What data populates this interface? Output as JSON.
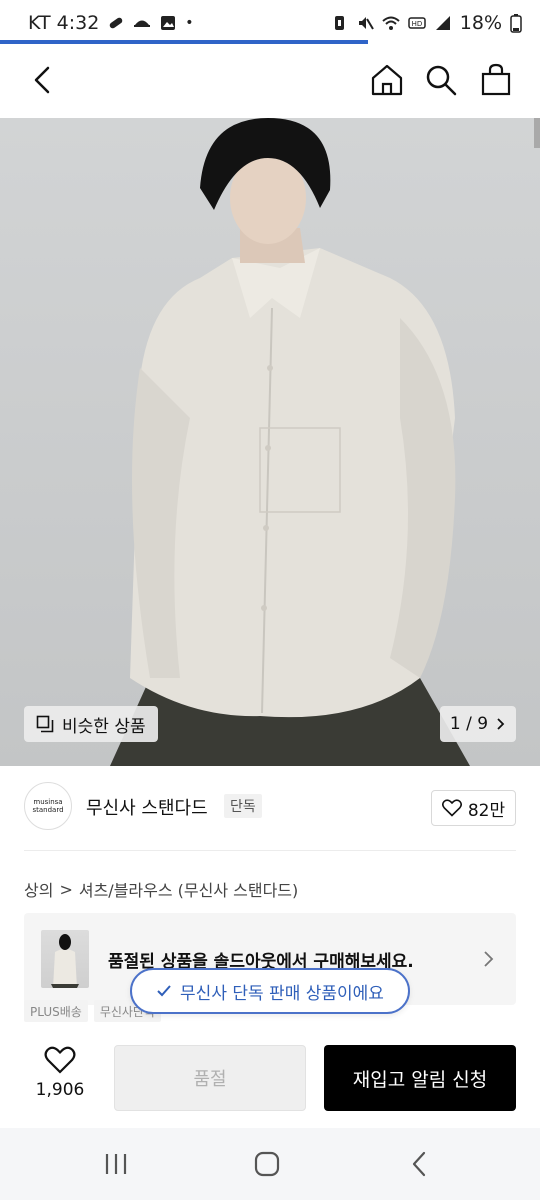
{
  "status_bar": {
    "carrier_time": "KT 4:32",
    "dot": "•",
    "battery": "18%",
    "icons": [
      "pill-icon",
      "cap-icon",
      "image-icon",
      "battery-saver-icon",
      "mute-icon",
      "wifi-icon",
      "hd-icon",
      "signal-icon",
      "battery-icon"
    ]
  },
  "colors": {
    "accent_blue": "#2f64c8",
    "toast_border": "#4c72c9",
    "primary_button": "#000000",
    "disabled_button": "#efefef"
  },
  "nav": {
    "back_icon": "chevron-left-icon",
    "home_icon": "home-icon",
    "search_icon": "search-icon",
    "cart_icon": "shopping-bag-icon"
  },
  "hero": {
    "similar_label": "비슷한 상품",
    "pager": "1 / 9"
  },
  "brand": {
    "logo_line1": "musinsa",
    "logo_line2": "standard",
    "name": "무신사 스탠다드",
    "exclusive_tag": "단독",
    "likes": "82만"
  },
  "breadcrumb": {
    "level1": "상의",
    "separator": ">",
    "level2": "셔츠/블라우스 (무신사 스탠다드)"
  },
  "soldout_banner": {
    "text": "품절된 상품을 솔드아웃에서 구매해보세요."
  },
  "tags": [
    "PLUS배송",
    "무신사단독"
  ],
  "toast": {
    "text": "무신사 단독 판매 상품이에요"
  },
  "bottom_bar": {
    "wish_count": "1,906",
    "soldout_label": "품절",
    "restock_label": "재입고 알림 신청"
  },
  "android_nav": {
    "recents_icon": "recents-icon",
    "home_icon": "android-home-icon",
    "back_icon": "android-back-icon"
  }
}
